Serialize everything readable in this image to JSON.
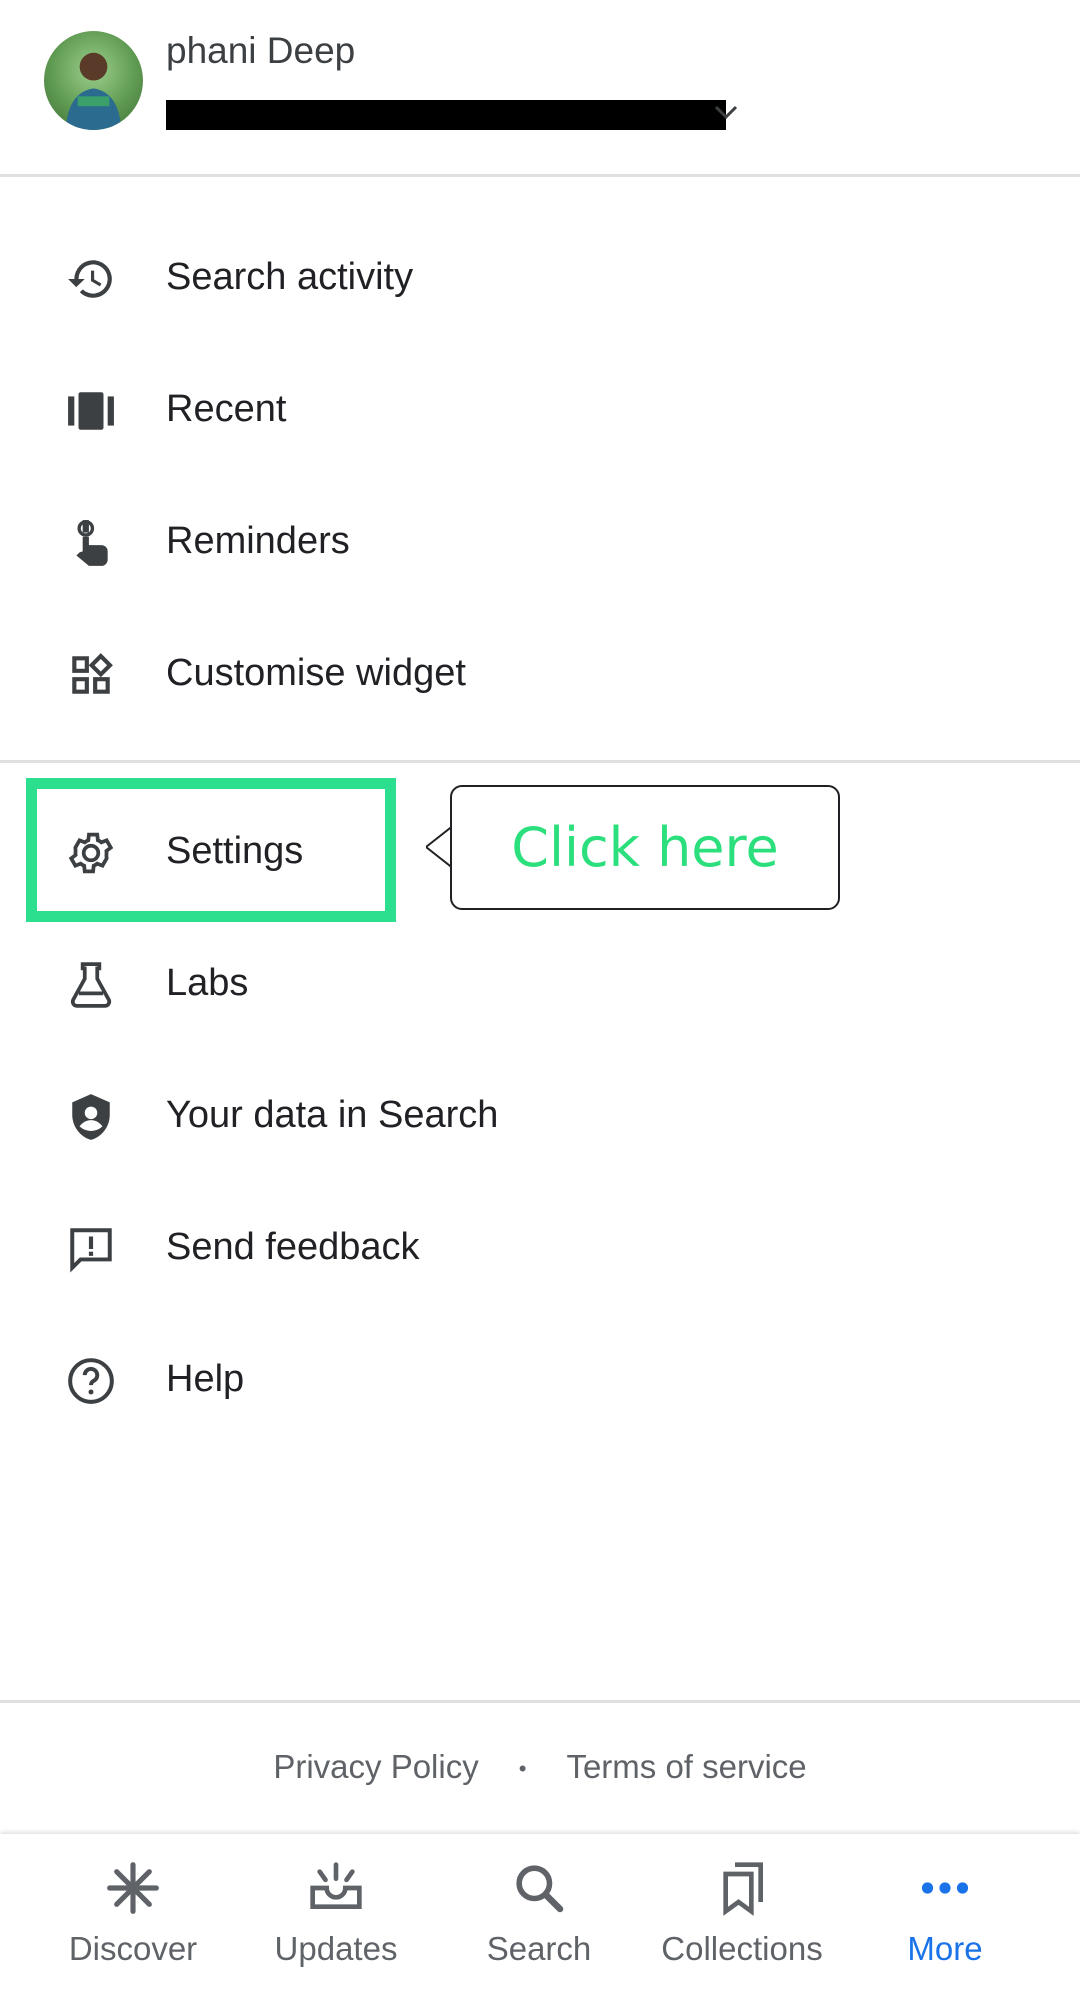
{
  "account": {
    "name": "phani Deep",
    "email_redacted": true
  },
  "menu": {
    "items": [
      {
        "label": "Search activity",
        "icon": "history-icon"
      },
      {
        "label": "Recent",
        "icon": "recent-cards-icon"
      },
      {
        "label": "Reminders",
        "icon": "reminder-hand-icon"
      },
      {
        "label": "Customise widget",
        "icon": "widgets-icon"
      },
      {
        "label": "Settings",
        "icon": "gear-icon"
      },
      {
        "label": "Labs",
        "icon": "flask-icon"
      },
      {
        "label": "Your data in Search",
        "icon": "shield-person-icon"
      },
      {
        "label": "Send feedback",
        "icon": "feedback-icon"
      },
      {
        "label": "Help",
        "icon": "help-icon"
      }
    ]
  },
  "annotation": {
    "callout_text": "Click here",
    "highlight_color": "#2bdf8e"
  },
  "footer": {
    "privacy": "Privacy Policy",
    "separator": "•",
    "terms": "Terms of service"
  },
  "bottom_nav": {
    "items": [
      {
        "label": "Discover",
        "icon": "asterisk-icon"
      },
      {
        "label": "Updates",
        "icon": "updates-tray-icon"
      },
      {
        "label": "Search",
        "icon": "search-icon"
      },
      {
        "label": "Collections",
        "icon": "collections-bookmark-icon"
      },
      {
        "label": "More",
        "icon": "more-dots-icon",
        "active": true
      }
    ],
    "active_color": "#1a73e8"
  }
}
